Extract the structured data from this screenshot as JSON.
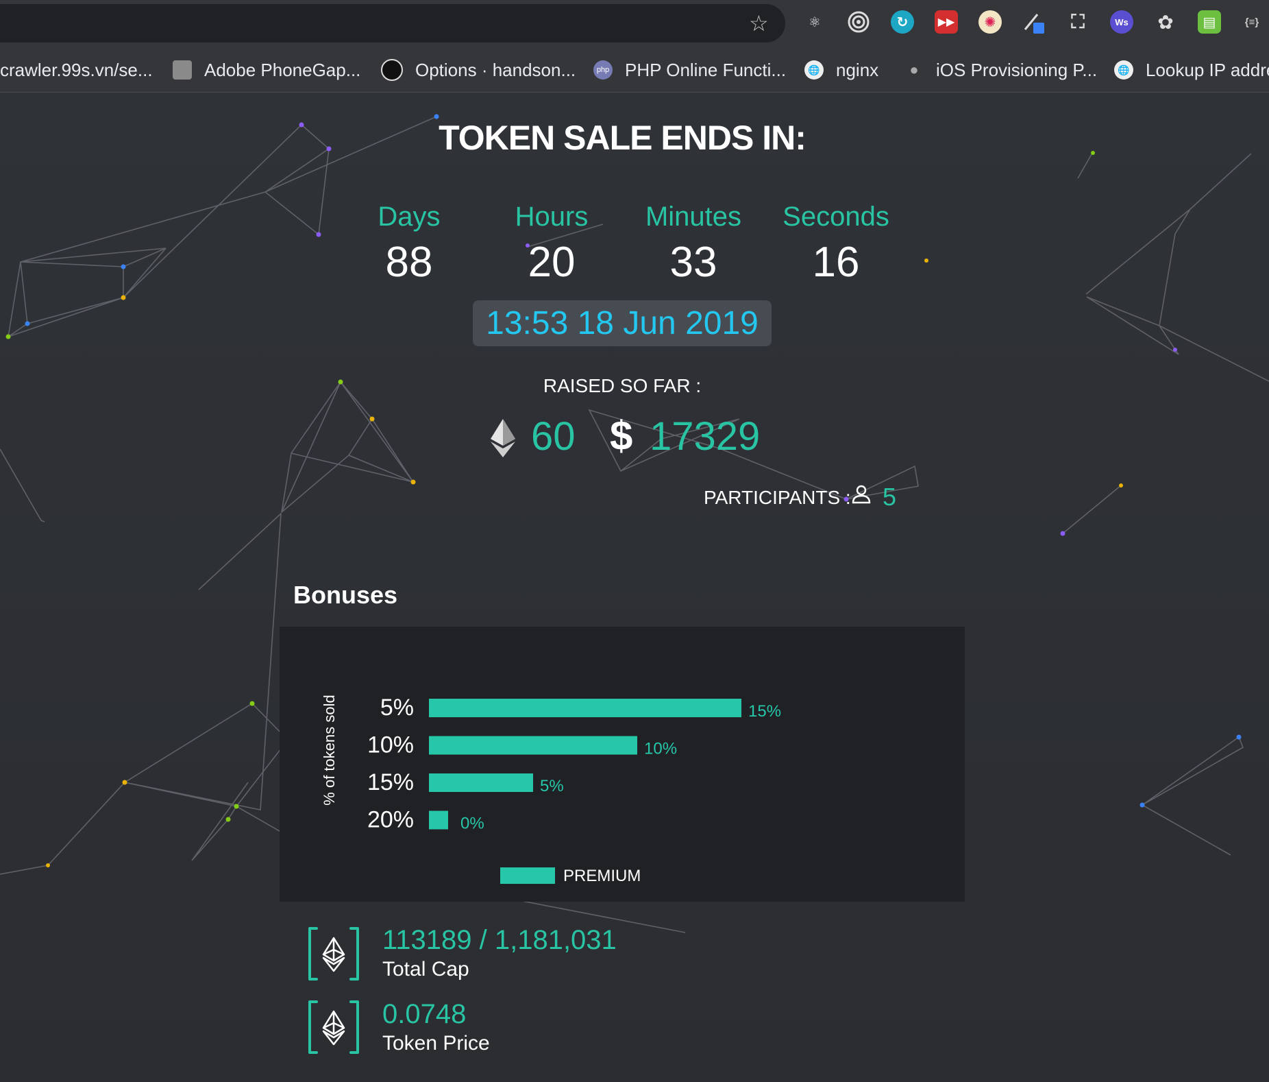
{
  "browser": {
    "bookmarks": [
      "crawler.99s.vn/se...",
      "Adobe PhoneGap...",
      "Options · handson...",
      "PHP Online Functi...",
      "nginx",
      "iOS Provisioning P...",
      "Lookup IP addre"
    ],
    "extension_icons": [
      "react-icon",
      "target-icon",
      "sync-icon",
      "fast-forward-icon",
      "atom-icon",
      "eyedropper-icon",
      "screenshot-icon",
      "ws-icon",
      "openai-icon",
      "printer-icon",
      "json-icon"
    ]
  },
  "sale": {
    "title": "TOKEN SALE ENDS IN:",
    "countdown": {
      "days_label": "Days",
      "days": "88",
      "hours_label": "Hours",
      "hours": "20",
      "minutes_label": "Minutes",
      "minutes": "33",
      "seconds_label": "Seconds",
      "seconds": "16"
    },
    "end_date": "13:53 18 Jun 2019",
    "raised_label": "RAISED SO FAR :",
    "eth_raised": "60",
    "usd_symbol": "$",
    "usd_raised": "17329",
    "participants_label": "PARTICIPANTS :",
    "participants_count": "5"
  },
  "bonuses": {
    "title": "Bonuses"
  },
  "chart_data": {
    "type": "bar",
    "orientation": "horizontal",
    "categories": [
      "5%",
      "10%",
      "15%",
      "20%"
    ],
    "series": [
      {
        "name": "PREMIUM",
        "values": [
          15,
          10,
          5,
          0
        ]
      }
    ],
    "value_labels": [
      "15%",
      "10%",
      "5%",
      "0%"
    ],
    "ylabel": "% of tokens sold",
    "xlabel": "",
    "xlim": [
      0,
      15
    ],
    "legend": "bottom",
    "grid": false,
    "color": "#26c6a9",
    "min_bar_value_display": true
  },
  "stats": {
    "total_cap_value": "113189 / 1,181,031",
    "total_cap_label": "Total Cap",
    "token_price_value": "0.0748",
    "token_price_label": "Token Price"
  },
  "colors": {
    "accent": "#28c4a4",
    "date": "#24c7ef",
    "background": "#2f3136",
    "chart_bg": "#202124"
  }
}
